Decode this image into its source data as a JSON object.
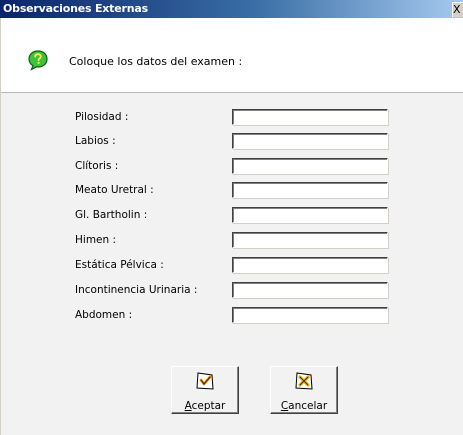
{
  "window": {
    "title": "Observaciones Externas",
    "close_label": "X"
  },
  "header": {
    "text": "Coloque los datos del examen :",
    "icon": "help-icon"
  },
  "form": {
    "fields": [
      {
        "label": "Pilosidad :",
        "value": ""
      },
      {
        "label": "Labios :",
        "value": ""
      },
      {
        "label": "Clítoris :",
        "value": ""
      },
      {
        "label": "Meato Uretral :",
        "value": ""
      },
      {
        "label": "Gl. Bartholin :",
        "value": ""
      },
      {
        "label": "Himen :",
        "value": ""
      },
      {
        "label": "Estática Pélvica :",
        "value": ""
      },
      {
        "label": "Incontinencia Urinaria :",
        "value": ""
      },
      {
        "label": "Abdomen :",
        "value": ""
      }
    ]
  },
  "buttons": {
    "accept": {
      "mnemonic": "A",
      "rest": "ceptar",
      "icon": "accept-check-icon"
    },
    "cancel": {
      "mnemonic": "C",
      "rest": "ancelar",
      "icon": "cancel-x-icon"
    }
  },
  "colors": {
    "titlebar_start": "#0a246a",
    "titlebar_end": "#a6caf0",
    "window_bg": "#f2f2f2",
    "icon_green": "#22aa22",
    "accept_mark": "#e07a00",
    "cancel_mark": "#e0a000"
  }
}
